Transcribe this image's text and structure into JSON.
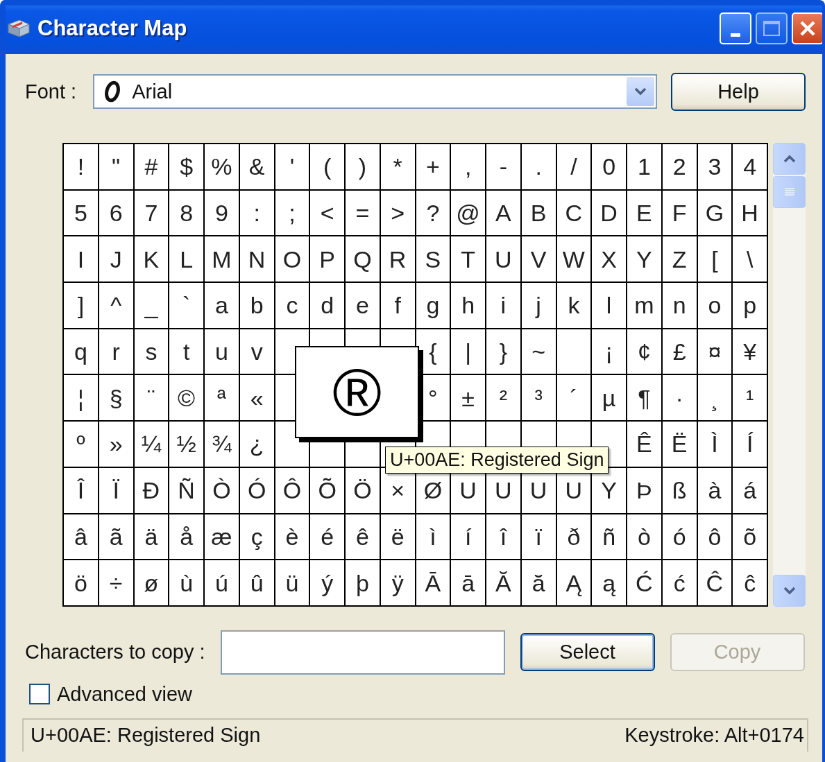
{
  "window": {
    "title": "Character Map"
  },
  "font": {
    "label": "Font :",
    "value": "Arial"
  },
  "help_button": {
    "label": "Help"
  },
  "grid": {
    "rows": [
      [
        "!",
        "\"",
        "#",
        "$",
        "%",
        "&",
        "'",
        "(",
        ")",
        "*",
        "+",
        ",",
        "-",
        ".",
        "/",
        "0",
        "1",
        "2",
        "3",
        "4"
      ],
      [
        "5",
        "6",
        "7",
        "8",
        "9",
        ":",
        ";",
        "<",
        "=",
        ">",
        "?",
        "@",
        "A",
        "B",
        "C",
        "D",
        "E",
        "F",
        "G",
        "H"
      ],
      [
        "I",
        "J",
        "K",
        "L",
        "M",
        "N",
        "O",
        "P",
        "Q",
        "R",
        "S",
        "T",
        "U",
        "V",
        "W",
        "X",
        "Y",
        "Z",
        "[",
        "\\"
      ],
      [
        "]",
        "^",
        "_",
        "`",
        "a",
        "b",
        "c",
        "d",
        "e",
        "f",
        "g",
        "h",
        "i",
        "j",
        "k",
        "l",
        "m",
        "n",
        "o",
        "p"
      ],
      [
        "q",
        "r",
        "s",
        "t",
        "u",
        "v",
        null,
        null,
        null,
        null,
        "{",
        "|",
        "}",
        "~",
        null,
        "¡",
        "¢",
        "£",
        "¤",
        "¥"
      ],
      [
        "¦",
        "§",
        "¨",
        "©",
        "ª",
        "«",
        null,
        null,
        null,
        null,
        "°",
        "±",
        "²",
        "³",
        "´",
        "µ",
        "¶",
        "·",
        "¸",
        "¹"
      ],
      [
        "º",
        "»",
        "¼",
        "½",
        "¾",
        "¿",
        null,
        null,
        null,
        null,
        null,
        null,
        null,
        null,
        null,
        null,
        "Ê",
        "Ë",
        "Ì",
        "Í"
      ],
      [
        "Î",
        "Ï",
        "Ð",
        "Ñ",
        "Ò",
        "Ó",
        "Ô",
        "Õ",
        "Ö",
        "×",
        "Ø",
        "U",
        "U",
        "U",
        "U",
        "Y",
        "Þ",
        "ß",
        "à",
        "á"
      ],
      [
        "â",
        "ã",
        "ä",
        "å",
        "æ",
        "ç",
        "è",
        "é",
        "ê",
        "ë",
        "ì",
        "í",
        "î",
        "ï",
        "ð",
        "ñ",
        "ò",
        "ó",
        "ô",
        "õ"
      ],
      [
        "ö",
        "÷",
        "ø",
        "ù",
        "ú",
        "û",
        "ü",
        "ý",
        "þ",
        "ÿ",
        "Ā",
        "ā",
        "Ă",
        "ă",
        "Ą",
        "ą",
        "Ć",
        "ć",
        "Ĉ",
        "ĉ"
      ]
    ]
  },
  "magnifier": {
    "char": "®"
  },
  "tooltip": "U+00AE: Registered Sign",
  "copy_field": {
    "label": "Characters to copy :"
  },
  "buttons": [
    {
      "label": "Select",
      "disabled": false
    },
    {
      "label": "Copy",
      "disabled": true
    }
  ],
  "advanced_view": {
    "label": "Advanced view",
    "checked": false
  },
  "status_bar": {
    "description": "U+00AE: Registered Sign",
    "keystroke": "Keystroke: Alt+0174"
  }
}
